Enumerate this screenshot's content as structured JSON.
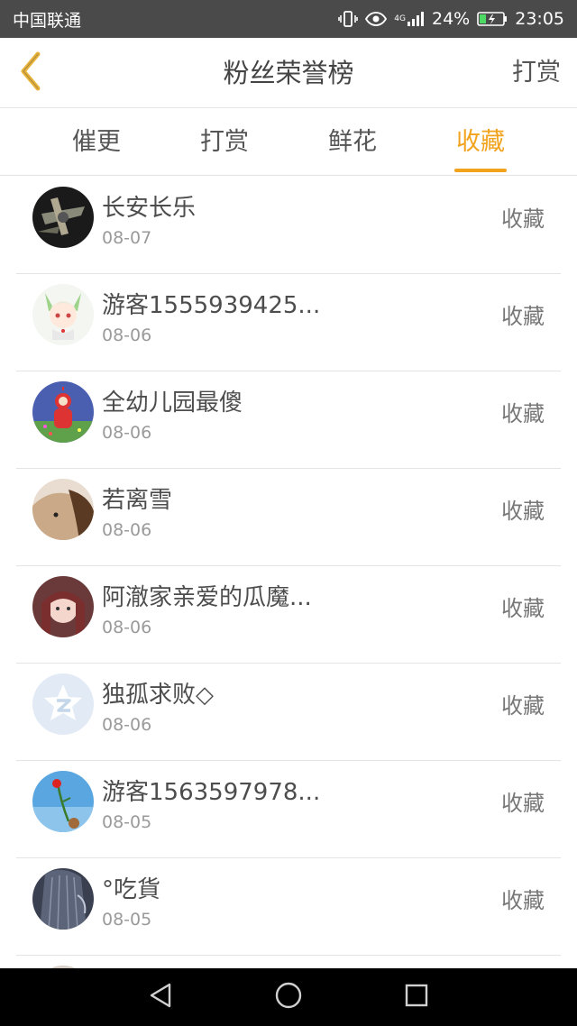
{
  "status_bar": {
    "carrier": "中国联通",
    "network": "4G",
    "battery": "24%",
    "time": "23:05",
    "icons": [
      "vibrate-icon",
      "eye-icon",
      "signal-icon",
      "battery-icon"
    ]
  },
  "header": {
    "title": "粉丝荣誉榜",
    "action_label": "打赏",
    "back_icon": "chevron-left-icon",
    "accent_color": "#e8b33a"
  },
  "tabs": [
    {
      "label": "催更",
      "active": false
    },
    {
      "label": "打赏",
      "active": false
    },
    {
      "label": "鲜花",
      "active": false
    },
    {
      "label": "收藏",
      "active": true
    }
  ],
  "tab_accent_color": "#f2a31e",
  "fans": [
    {
      "name": "长安长乐",
      "date": "08-07",
      "type": "收藏"
    },
    {
      "name": "游客1555939425...",
      "date": "08-06",
      "type": "收藏"
    },
    {
      "name": "全幼儿园最傻",
      "date": "08-06",
      "type": "收藏"
    },
    {
      "name": "若离雪",
      "date": "08-06",
      "type": "收藏"
    },
    {
      "name": "阿澈家亲爱的瓜魔...",
      "date": "08-06",
      "type": "收藏"
    },
    {
      "name": "独孤求败◇",
      "date": "08-06",
      "type": "收藏"
    },
    {
      "name": "游客1563597978...",
      "date": "08-05",
      "type": "收藏"
    },
    {
      "name": "°吃貨",
      "date": "08-05",
      "type": "收藏"
    }
  ],
  "nav_bar": {
    "icons": [
      "back-triangle-icon",
      "home-circle-icon",
      "recents-square-icon"
    ]
  }
}
